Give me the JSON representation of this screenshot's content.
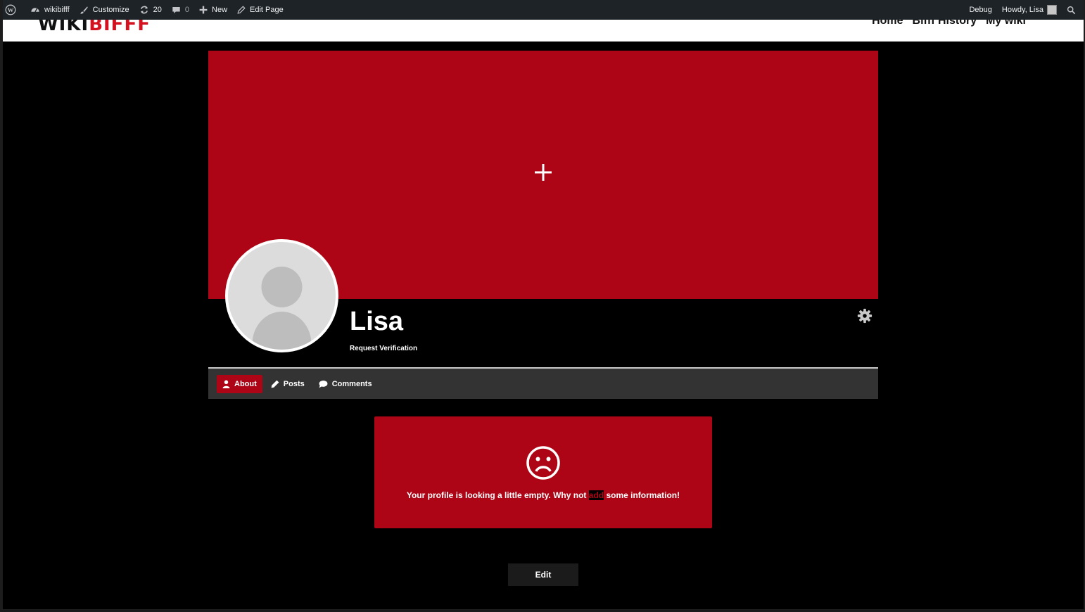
{
  "admin_bar": {
    "site_name": "wikibifff",
    "customize": "Customize",
    "updates_count": "20",
    "comments_count": "0",
    "new_label": "New",
    "edit_page": "Edit Page",
    "debug": "Debug",
    "howdy": "Howdy, Lisa"
  },
  "site": {
    "logo_part1": "WIKI",
    "logo_part2": "BIFFF",
    "nav": [
      "Home",
      "Bifff History",
      "My wiki"
    ]
  },
  "profile": {
    "name": "Lisa",
    "request_verification": "Request Verification",
    "tabs": [
      {
        "label": "About",
        "icon": "user-icon",
        "active": true
      },
      {
        "label": "Posts",
        "icon": "pencil-icon",
        "active": false
      },
      {
        "label": "Comments",
        "icon": "comment-icon",
        "active": false
      }
    ],
    "empty_message_before": "Your profile is looking a little empty. Why not ",
    "empty_message_link": "add",
    "empty_message_after": " some information!",
    "edit_button": "Edit"
  },
  "colors": {
    "accent": "#ad0515",
    "admin_bar": "#1d2327",
    "page_bg": "#000000",
    "tab_bar": "#333333"
  }
}
